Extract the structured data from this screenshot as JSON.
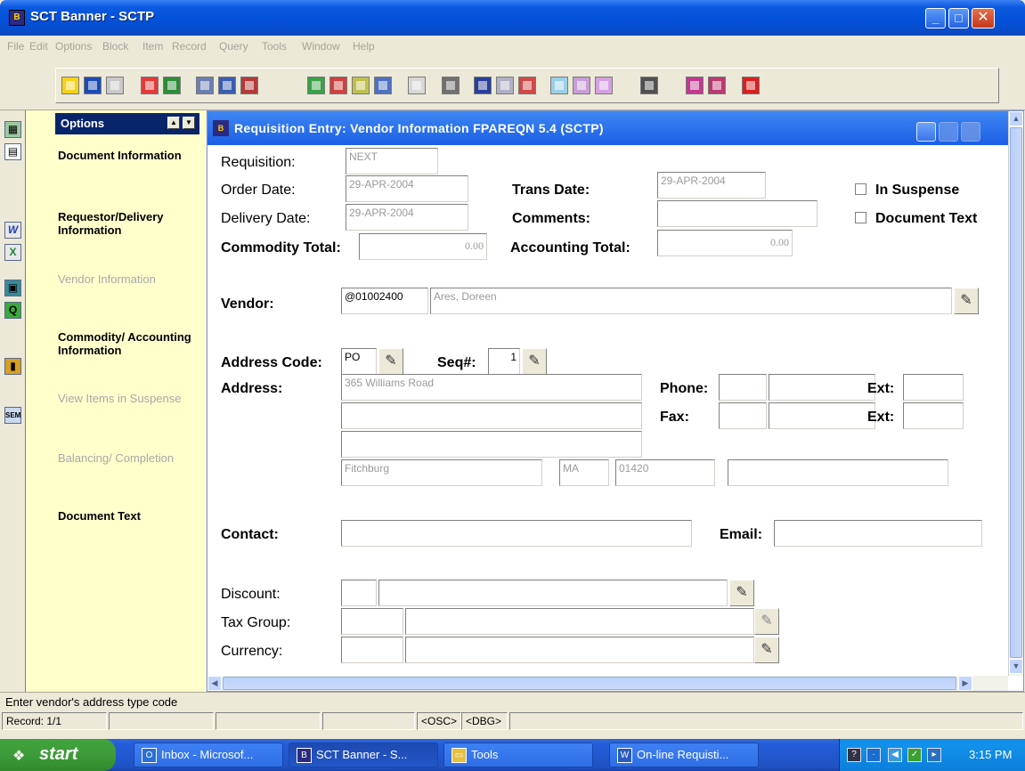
{
  "window": {
    "title": "SCT Banner - SCTP",
    "icon": "banner-app-icon"
  },
  "menu": [
    "File",
    "Edit",
    "Options",
    "Block",
    "Item",
    "Record",
    "Query",
    "Tools",
    "Window",
    "Help"
  ],
  "options_panel": {
    "title": "Options",
    "items": [
      {
        "label": "Document Information",
        "enabled": true
      },
      {
        "label": "Requestor/Delivery Information",
        "enabled": true
      },
      {
        "label": "Vendor Information",
        "enabled": false
      },
      {
        "label": "Commodity/ Accounting Information",
        "enabled": true
      },
      {
        "label": "View Items in Suspense",
        "enabled": false
      },
      {
        "label": "Balancing/ Completion",
        "enabled": false
      },
      {
        "label": "Document Text",
        "enabled": true
      }
    ]
  },
  "form": {
    "title": "Requisition Entry: Vendor Information  FPAREQN  5.4  (SCTP)",
    "requisition": {
      "label": "Requisition:",
      "value": "NEXT"
    },
    "order_date": {
      "label": "Order Date:",
      "value": "29-APR-2004"
    },
    "delivery_date": {
      "label": "Delivery Date:",
      "value": "29-APR-2004"
    },
    "commodity_total": {
      "label": "Commodity Total:",
      "value": "0.00"
    },
    "trans_date": {
      "label": "Trans Date:",
      "value": "29-APR-2004"
    },
    "comments": {
      "label": "Comments:",
      "value": ""
    },
    "accounting_total": {
      "label": "Accounting Total:",
      "value": "0.00"
    },
    "in_suspense": {
      "label": "In Suspense",
      "checked": false
    },
    "document_text": {
      "label": "Document Text",
      "checked": false
    },
    "vendor": {
      "label": "Vendor:",
      "id": "@01002400",
      "name": "Ares, Doreen"
    },
    "address_code": {
      "label": "Address Code:",
      "value": "PO"
    },
    "seq": {
      "label": "Seq#:",
      "value": "1"
    },
    "address": {
      "label": "Address:",
      "line1": "365 Williams Road",
      "line2": "",
      "line3": "",
      "city": "Fitchburg",
      "state": "MA",
      "zip": "01420",
      "nation": ""
    },
    "phone": {
      "label": "Phone:",
      "ext_label": "Ext:"
    },
    "fax": {
      "label": "Fax:",
      "ext_label": "Ext:"
    },
    "contact": {
      "label": "Contact:",
      "value": ""
    },
    "email": {
      "label": "Email:",
      "value": ""
    },
    "discount": {
      "label": "Discount:"
    },
    "tax_group": {
      "label": "Tax Group:"
    },
    "currency": {
      "label": "Currency:"
    }
  },
  "hint": "Enter vendor's address type code",
  "status": {
    "record": "Record: 1/1",
    "osc": "<OSC>",
    "dbg": "<DBG>"
  },
  "taskbar": {
    "start": "start",
    "tasks": [
      "Inbox - Microsof...",
      "SCT Banner - S...",
      "Tools",
      "On-line Requisti..."
    ],
    "clock": "3:15 PM"
  }
}
